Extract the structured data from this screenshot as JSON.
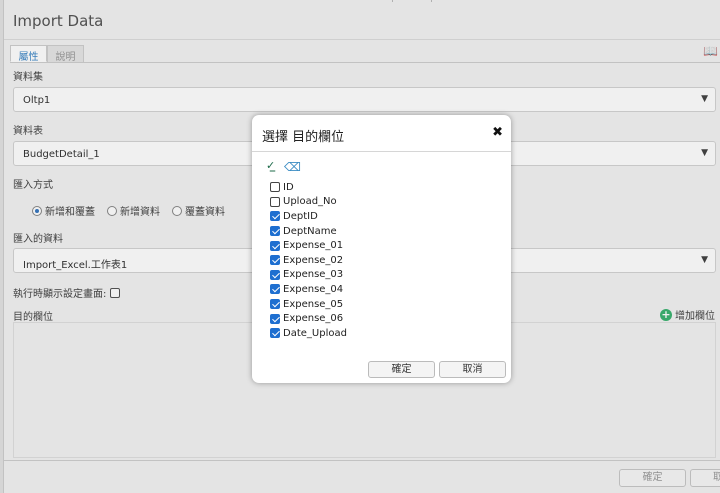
{
  "window": {
    "title": "Import Data"
  },
  "tabs": [
    {
      "label": "屬性"
    },
    {
      "label": "說明"
    }
  ],
  "form": {
    "dataset_label": "資料集",
    "dataset_value": "Oltp1",
    "table_label": "資料表",
    "table_value": "BudgetDetail_1",
    "import_mode_label": "匯入方式",
    "import_modes": [
      "新增和覆蓋",
      "新增資料",
      "覆蓋資料"
    ],
    "import_source_label": "匯入的資料",
    "import_source_value": "Import_Excel.工作表1",
    "show_settings_label": "執行時顯示設定畫面:",
    "target_columns_label": "目的欄位",
    "add_column_label": "增加欄位"
  },
  "footer": {
    "confirm_label": "確定",
    "cancel_label": "取"
  },
  "dialog": {
    "title": "選擇 目的欄位",
    "close": "✖",
    "items": [
      {
        "label": "ID",
        "checked": false
      },
      {
        "label": "Upload_No",
        "checked": false
      },
      {
        "label": "DeptID",
        "checked": true
      },
      {
        "label": "DeptName",
        "checked": true
      },
      {
        "label": "Expense_01",
        "checked": true
      },
      {
        "label": "Expense_02",
        "checked": true
      },
      {
        "label": "Expense_03",
        "checked": true
      },
      {
        "label": "Expense_04",
        "checked": true
      },
      {
        "label": "Expense_05",
        "checked": true
      },
      {
        "label": "Expense_06",
        "checked": true
      },
      {
        "label": "Date_Upload",
        "checked": true
      }
    ],
    "ok_label": "確定",
    "cancel_label": "取消"
  }
}
